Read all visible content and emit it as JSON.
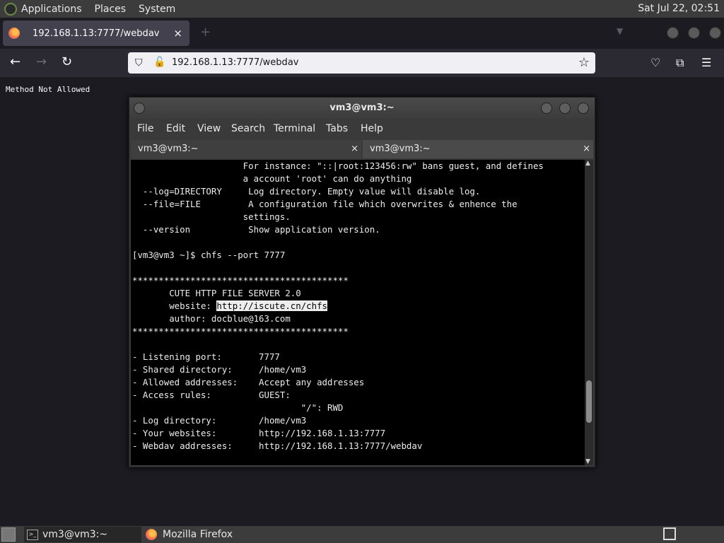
{
  "top_panel": {
    "menus": [
      "Applications",
      "Places",
      "System"
    ],
    "clock": "Sat Jul 22, 02:51"
  },
  "browser": {
    "tab_title": "192.168.1.13:7777/webdav",
    "tab_close": "×",
    "new_tab": "+",
    "url": "192.168.1.13:7777/webdav",
    "page_text": "Method Not Allowed"
  },
  "terminal": {
    "title": "vm3@vm3:~",
    "menu": [
      "File",
      "Edit",
      "View",
      "Search",
      "Terminal",
      "Tabs",
      "Help"
    ],
    "tabs": [
      {
        "label": "vm3@vm3:~",
        "close": "×"
      },
      {
        "label": "vm3@vm3:~",
        "close": "×"
      }
    ],
    "lines": [
      "                     For instance: \"::|root:123456:rw\" bans guest, and defines",
      "                     a account 'root' can do anything",
      "  --log=DIRECTORY     Log directory. Empty value will disable log.",
      "  --file=FILE         A configuration file which overwrites & enhence the",
      "                     settings.",
      "  --version           Show application version.",
      "",
      "[vm3@vm3 ~]$ chfs --port 7777",
      "",
      "*****************************************",
      "       CUTE HTTP FILE SERVER 2.0",
      "       website: ",
      "       author: docblue@163.com",
      "*****************************************",
      "",
      "- Listening port:       7777",
      "- Shared directory:     /home/vm3",
      "- Allowed addresses:    Accept any addresses",
      "- Access rules:         GUEST:",
      "                                \"/\": RWD",
      "- Log directory:        /home/vm3",
      "- Your websites:        http://192.168.1.13:7777",
      "- Webdav addresses:     http://192.168.1.13:7777/webdav"
    ],
    "selected_link": "http://iscute.cn/chfs"
  },
  "taskbar": {
    "items": [
      "vm3@vm3:~",
      "Mozilla Firefox"
    ]
  }
}
